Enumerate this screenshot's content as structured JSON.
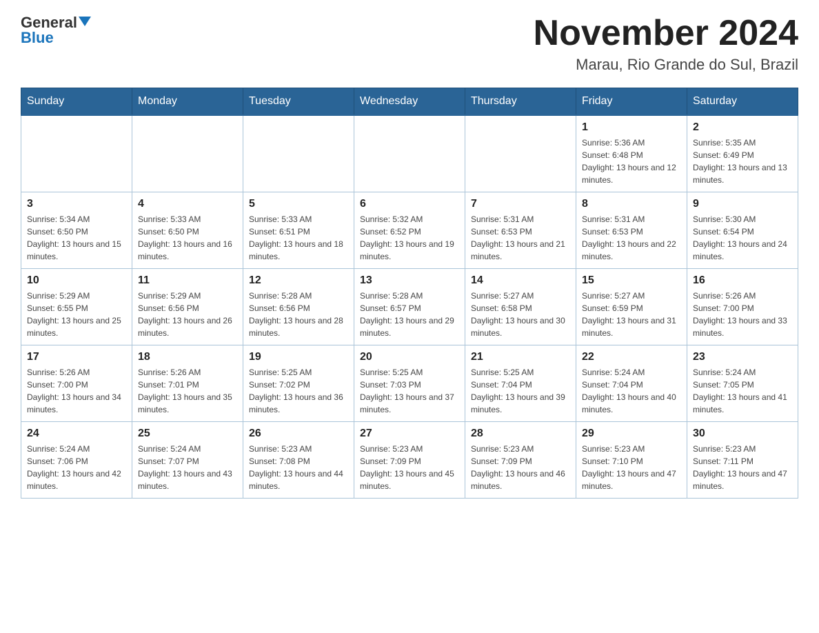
{
  "header": {
    "logo_general": "General",
    "logo_blue": "Blue",
    "month_title": "November 2024",
    "location": "Marau, Rio Grande do Sul, Brazil"
  },
  "days_of_week": [
    "Sunday",
    "Monday",
    "Tuesday",
    "Wednesday",
    "Thursday",
    "Friday",
    "Saturday"
  ],
  "weeks": [
    [
      {
        "day": "",
        "sunrise": "",
        "sunset": "",
        "daylight": ""
      },
      {
        "day": "",
        "sunrise": "",
        "sunset": "",
        "daylight": ""
      },
      {
        "day": "",
        "sunrise": "",
        "sunset": "",
        "daylight": ""
      },
      {
        "day": "",
        "sunrise": "",
        "sunset": "",
        "daylight": ""
      },
      {
        "day": "",
        "sunrise": "",
        "sunset": "",
        "daylight": ""
      },
      {
        "day": "1",
        "sunrise": "Sunrise: 5:36 AM",
        "sunset": "Sunset: 6:48 PM",
        "daylight": "Daylight: 13 hours and 12 minutes."
      },
      {
        "day": "2",
        "sunrise": "Sunrise: 5:35 AM",
        "sunset": "Sunset: 6:49 PM",
        "daylight": "Daylight: 13 hours and 13 minutes."
      }
    ],
    [
      {
        "day": "3",
        "sunrise": "Sunrise: 5:34 AM",
        "sunset": "Sunset: 6:50 PM",
        "daylight": "Daylight: 13 hours and 15 minutes."
      },
      {
        "day": "4",
        "sunrise": "Sunrise: 5:33 AM",
        "sunset": "Sunset: 6:50 PM",
        "daylight": "Daylight: 13 hours and 16 minutes."
      },
      {
        "day": "5",
        "sunrise": "Sunrise: 5:33 AM",
        "sunset": "Sunset: 6:51 PM",
        "daylight": "Daylight: 13 hours and 18 minutes."
      },
      {
        "day": "6",
        "sunrise": "Sunrise: 5:32 AM",
        "sunset": "Sunset: 6:52 PM",
        "daylight": "Daylight: 13 hours and 19 minutes."
      },
      {
        "day": "7",
        "sunrise": "Sunrise: 5:31 AM",
        "sunset": "Sunset: 6:53 PM",
        "daylight": "Daylight: 13 hours and 21 minutes."
      },
      {
        "day": "8",
        "sunrise": "Sunrise: 5:31 AM",
        "sunset": "Sunset: 6:53 PM",
        "daylight": "Daylight: 13 hours and 22 minutes."
      },
      {
        "day": "9",
        "sunrise": "Sunrise: 5:30 AM",
        "sunset": "Sunset: 6:54 PM",
        "daylight": "Daylight: 13 hours and 24 minutes."
      }
    ],
    [
      {
        "day": "10",
        "sunrise": "Sunrise: 5:29 AM",
        "sunset": "Sunset: 6:55 PM",
        "daylight": "Daylight: 13 hours and 25 minutes."
      },
      {
        "day": "11",
        "sunrise": "Sunrise: 5:29 AM",
        "sunset": "Sunset: 6:56 PM",
        "daylight": "Daylight: 13 hours and 26 minutes."
      },
      {
        "day": "12",
        "sunrise": "Sunrise: 5:28 AM",
        "sunset": "Sunset: 6:56 PM",
        "daylight": "Daylight: 13 hours and 28 minutes."
      },
      {
        "day": "13",
        "sunrise": "Sunrise: 5:28 AM",
        "sunset": "Sunset: 6:57 PM",
        "daylight": "Daylight: 13 hours and 29 minutes."
      },
      {
        "day": "14",
        "sunrise": "Sunrise: 5:27 AM",
        "sunset": "Sunset: 6:58 PM",
        "daylight": "Daylight: 13 hours and 30 minutes."
      },
      {
        "day": "15",
        "sunrise": "Sunrise: 5:27 AM",
        "sunset": "Sunset: 6:59 PM",
        "daylight": "Daylight: 13 hours and 31 minutes."
      },
      {
        "day": "16",
        "sunrise": "Sunrise: 5:26 AM",
        "sunset": "Sunset: 7:00 PM",
        "daylight": "Daylight: 13 hours and 33 minutes."
      }
    ],
    [
      {
        "day": "17",
        "sunrise": "Sunrise: 5:26 AM",
        "sunset": "Sunset: 7:00 PM",
        "daylight": "Daylight: 13 hours and 34 minutes."
      },
      {
        "day": "18",
        "sunrise": "Sunrise: 5:26 AM",
        "sunset": "Sunset: 7:01 PM",
        "daylight": "Daylight: 13 hours and 35 minutes."
      },
      {
        "day": "19",
        "sunrise": "Sunrise: 5:25 AM",
        "sunset": "Sunset: 7:02 PM",
        "daylight": "Daylight: 13 hours and 36 minutes."
      },
      {
        "day": "20",
        "sunrise": "Sunrise: 5:25 AM",
        "sunset": "Sunset: 7:03 PM",
        "daylight": "Daylight: 13 hours and 37 minutes."
      },
      {
        "day": "21",
        "sunrise": "Sunrise: 5:25 AM",
        "sunset": "Sunset: 7:04 PM",
        "daylight": "Daylight: 13 hours and 39 minutes."
      },
      {
        "day": "22",
        "sunrise": "Sunrise: 5:24 AM",
        "sunset": "Sunset: 7:04 PM",
        "daylight": "Daylight: 13 hours and 40 minutes."
      },
      {
        "day": "23",
        "sunrise": "Sunrise: 5:24 AM",
        "sunset": "Sunset: 7:05 PM",
        "daylight": "Daylight: 13 hours and 41 minutes."
      }
    ],
    [
      {
        "day": "24",
        "sunrise": "Sunrise: 5:24 AM",
        "sunset": "Sunset: 7:06 PM",
        "daylight": "Daylight: 13 hours and 42 minutes."
      },
      {
        "day": "25",
        "sunrise": "Sunrise: 5:24 AM",
        "sunset": "Sunset: 7:07 PM",
        "daylight": "Daylight: 13 hours and 43 minutes."
      },
      {
        "day": "26",
        "sunrise": "Sunrise: 5:23 AM",
        "sunset": "Sunset: 7:08 PM",
        "daylight": "Daylight: 13 hours and 44 minutes."
      },
      {
        "day": "27",
        "sunrise": "Sunrise: 5:23 AM",
        "sunset": "Sunset: 7:09 PM",
        "daylight": "Daylight: 13 hours and 45 minutes."
      },
      {
        "day": "28",
        "sunrise": "Sunrise: 5:23 AM",
        "sunset": "Sunset: 7:09 PM",
        "daylight": "Daylight: 13 hours and 46 minutes."
      },
      {
        "day": "29",
        "sunrise": "Sunrise: 5:23 AM",
        "sunset": "Sunset: 7:10 PM",
        "daylight": "Daylight: 13 hours and 47 minutes."
      },
      {
        "day": "30",
        "sunrise": "Sunrise: 5:23 AM",
        "sunset": "Sunset: 7:11 PM",
        "daylight": "Daylight: 13 hours and 47 minutes."
      }
    ]
  ]
}
